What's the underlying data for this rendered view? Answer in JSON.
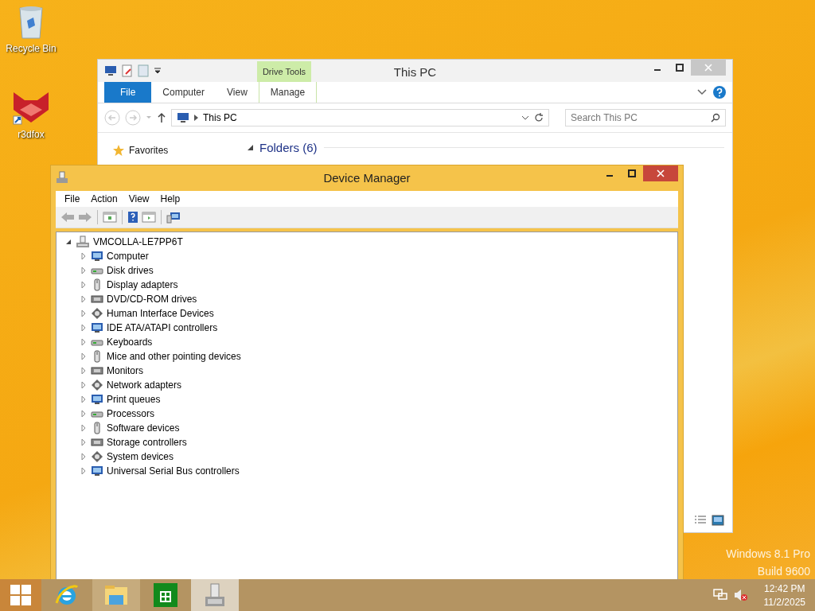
{
  "desktop_icons": [
    {
      "label": "Recycle Bin"
    },
    {
      "label": "r3dfox"
    }
  ],
  "explorer": {
    "title": "This PC",
    "context_group": "Drive Tools",
    "ribbon_tabs": [
      {
        "label": "File",
        "kind": "file"
      },
      {
        "label": "Computer",
        "kind": "normal"
      },
      {
        "label": "View",
        "kind": "normal"
      },
      {
        "label": "Manage",
        "kind": "contextual"
      }
    ],
    "address": "This PC",
    "search": {
      "placeholder": "Search This PC"
    },
    "nav": [
      {
        "label": "Favorites"
      }
    ],
    "section": "Folders (6)"
  },
  "device_manager": {
    "title": "Device Manager",
    "menu": [
      "File",
      "Action",
      "View",
      "Help"
    ],
    "tree": {
      "label": "VMCOLLA-LE7PP6T",
      "expanded": true,
      "children": [
        {
          "label": "Computer",
          "expanded": false
        },
        {
          "label": "Disk drives",
          "expanded": false
        },
        {
          "label": "Display adapters",
          "expanded": false
        },
        {
          "label": "DVD/CD-ROM drives",
          "expanded": false
        },
        {
          "label": "Human Interface Devices",
          "expanded": false
        },
        {
          "label": "IDE ATA/ATAPI controllers",
          "expanded": false
        },
        {
          "label": "Keyboards",
          "expanded": false
        },
        {
          "label": "Mice and other pointing devices",
          "expanded": false
        },
        {
          "label": "Monitors",
          "expanded": false
        },
        {
          "label": "Network adapters",
          "expanded": false
        },
        {
          "label": "Print queues",
          "expanded": false
        },
        {
          "label": "Processors",
          "expanded": false
        },
        {
          "label": "Software devices",
          "expanded": false
        },
        {
          "label": "Storage controllers",
          "expanded": false
        },
        {
          "label": "System devices",
          "expanded": false
        },
        {
          "label": "Universal Serial Bus controllers",
          "expanded": false
        }
      ]
    }
  },
  "os_version": [
    "Windows 8.1 Pro",
    "Build 9600"
  ],
  "taskbar": {
    "apps": [
      {
        "kind": "ie",
        "selected": false
      },
      {
        "kind": "explorer",
        "selected": false
      },
      {
        "kind": "store",
        "selected": false
      },
      {
        "kind": "devmgr",
        "selected": true
      }
    ],
    "time": "12:42 PM",
    "date": "11/2/2025"
  }
}
